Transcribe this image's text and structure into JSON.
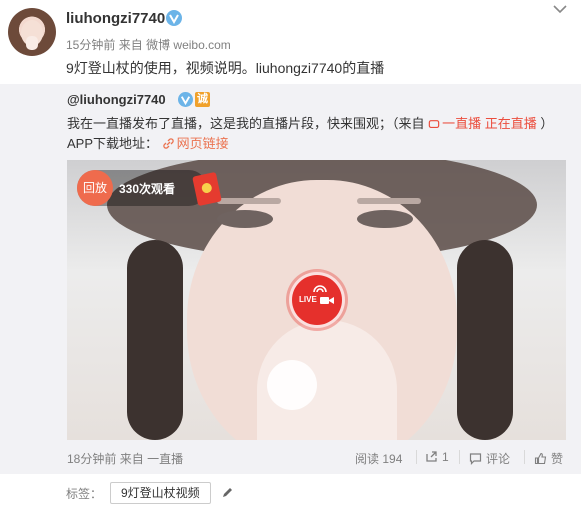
{
  "header": {
    "username": "liuhongzi7740",
    "time": "15分钟前",
    "from_label": "来自",
    "client": "微博 weibo.com",
    "post_text": "9灯登山杖的使用，视频说明。liuhongzi7740的直播"
  },
  "repost": {
    "username": "@liuhongzi7740",
    "cheng_badge": "诚",
    "text_before": "我在一直播发布了直播，这是我的直播片段，快来围观；（来自",
    "app_link": "一直播 正在直播",
    "text_after": "）APP下载地址：",
    "web_link": "网页链接",
    "video": {
      "replay_label": "回放",
      "viewers": "330次观看",
      "live_label": "LIVE"
    },
    "footer": {
      "time": "18分钟前",
      "from_label": "来自",
      "client": "一直播",
      "reads_label": "阅读",
      "reads": "194",
      "shares": "1",
      "comments_label": "评论",
      "likes_label": "赞"
    }
  },
  "tags": {
    "label": "标签：",
    "items": [
      "9灯登山杖视频"
    ]
  },
  "colors": {
    "accent": "#eb7350",
    "live_red": "#e5302c",
    "verified_blue": "#6cb4e8"
  }
}
